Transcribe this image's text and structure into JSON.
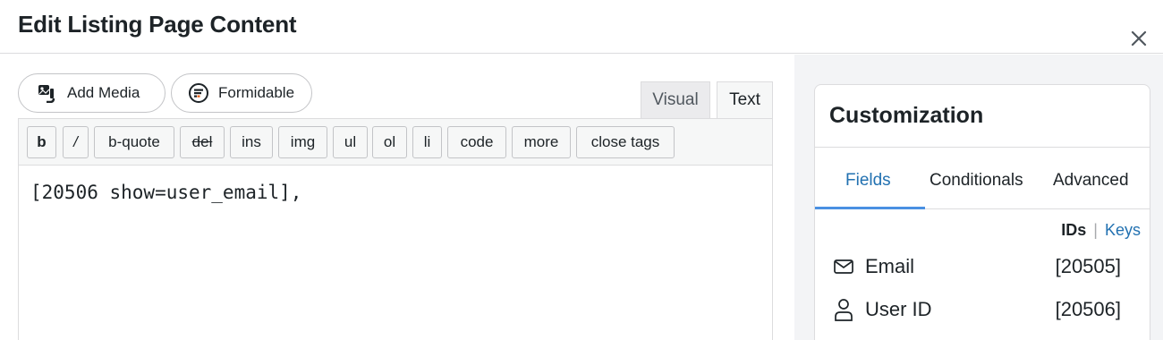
{
  "header": {
    "title": "Edit Listing Page Content",
    "close_icon": "close-icon"
  },
  "media_buttons": {
    "add_media": "Add Media",
    "formidable": "Formidable"
  },
  "editor_tabs": {
    "visual": "Visual",
    "text": "Text",
    "active": "Text"
  },
  "quicktags": [
    {
      "label": "b"
    },
    {
      "label": "/"
    },
    {
      "label": "b-quote"
    },
    {
      "label": "del"
    },
    {
      "label": "ins"
    },
    {
      "label": "img"
    },
    {
      "label": "ul"
    },
    {
      "label": "ol"
    },
    {
      "label": "li"
    },
    {
      "label": "code"
    },
    {
      "label": "more"
    },
    {
      "label": "close tags"
    }
  ],
  "editor": {
    "content": "[20506 show=user_email],"
  },
  "customization": {
    "title": "Customization",
    "tabs": [
      {
        "label": "Fields",
        "active": true
      },
      {
        "label": "Conditionals",
        "active": false
      },
      {
        "label": "Advanced",
        "active": false
      }
    ],
    "ids_label": "IDs",
    "separator": "|",
    "keys_label": "Keys",
    "fields": [
      {
        "icon": "envelope-icon",
        "label": "Email",
        "id": "[20505]"
      },
      {
        "icon": "user-icon",
        "label": "User ID",
        "id": "[20506]"
      }
    ]
  },
  "colors": {
    "accent": "#2271b1",
    "tab_underline": "#4a90e2",
    "sidebar_bg": "#f3f4f6"
  }
}
